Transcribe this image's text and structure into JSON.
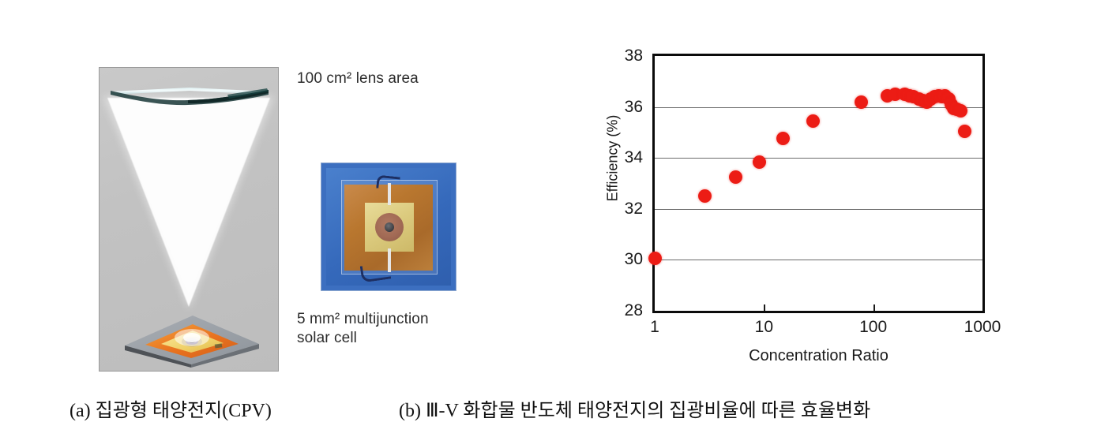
{
  "figure": {
    "panel_a": {
      "caption": "(a) 집광형 태양전지(CPV)",
      "lens_area_label": "100 cm² lens area",
      "cell_area_label": "5 mm² multijunction\nsolar cell",
      "illustration_name": "cpv-concentrator-illustration",
      "photo_name": "multijunction-solar-cell-photo"
    },
    "panel_b": {
      "caption": "(b)  Ⅲ-V 화합물 반도체 태양전지의 집광비율에 따른 효율변화"
    }
  },
  "chart_data": {
    "type": "scatter",
    "title": "",
    "xlabel": "Concentration Ratio",
    "ylabel": "Efficiency (%)",
    "xscale": "log",
    "xlim": [
      1,
      1000
    ],
    "ylim": [
      28,
      38
    ],
    "grid": true,
    "legend": null,
    "marker_color": "#ec1c15",
    "xticks": [
      "1",
      "10",
      "100",
      "1000"
    ],
    "xtick_values": [
      1,
      10,
      100,
      1000
    ],
    "yticks": [
      "28",
      "30",
      "32",
      "34",
      "36",
      "38"
    ],
    "ytick_values": [
      28,
      30,
      32,
      34,
      36,
      38
    ],
    "points": [
      {
        "x": 1,
        "y": 30.05
      },
      {
        "x": 2.9,
        "y": 32.5
      },
      {
        "x": 5.5,
        "y": 33.25
      },
      {
        "x": 9,
        "y": 33.85
      },
      {
        "x": 15,
        "y": 34.75
      },
      {
        "x": 28,
        "y": 35.45
      },
      {
        "x": 78,
        "y": 36.2
      },
      {
        "x": 135,
        "y": 36.45
      },
      {
        "x": 160,
        "y": 36.5
      },
      {
        "x": 195,
        "y": 36.5
      },
      {
        "x": 215,
        "y": 36.45
      },
      {
        "x": 235,
        "y": 36.4
      },
      {
        "x": 260,
        "y": 36.3
      },
      {
        "x": 285,
        "y": 36.25
      },
      {
        "x": 310,
        "y": 36.2
      },
      {
        "x": 335,
        "y": 36.3
      },
      {
        "x": 365,
        "y": 36.4
      },
      {
        "x": 395,
        "y": 36.45
      },
      {
        "x": 425,
        "y": 36.4
      },
      {
        "x": 455,
        "y": 36.45
      },
      {
        "x": 490,
        "y": 36.3
      },
      {
        "x": 520,
        "y": 36.1
      },
      {
        "x": 545,
        "y": 35.95
      },
      {
        "x": 585,
        "y": 35.9
      },
      {
        "x": 630,
        "y": 35.85
      },
      {
        "x": 690,
        "y": 35.05
      }
    ]
  }
}
